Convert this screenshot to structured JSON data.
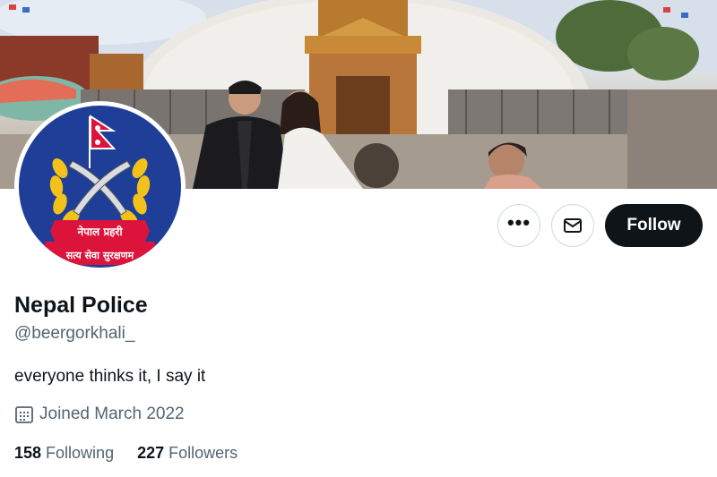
{
  "profile": {
    "display_name": "Nepal Police",
    "handle": "@beergorkhali_",
    "bio": "everyone thinks it, I say it",
    "joined": "Joined March 2022",
    "avatar_text_top": "नेपाल प्रहरी",
    "avatar_text_bottom": "सत्य सेवा सुरक्षणम"
  },
  "actions": {
    "more_label": "•••",
    "follow_label": "Follow"
  },
  "stats": {
    "following_count": "158",
    "following_label": "Following",
    "followers_count": "227",
    "followers_label": "Followers"
  },
  "icons": {
    "more": "more-icon",
    "mail": "envelope-icon",
    "calendar": "calendar-icon"
  },
  "colors": {
    "follow_bg": "#0f1419",
    "muted_text": "#536471",
    "avatar_bg": "#1f3e97",
    "flag_red": "#dc143c",
    "emblem_gold": "#f2c21b"
  }
}
